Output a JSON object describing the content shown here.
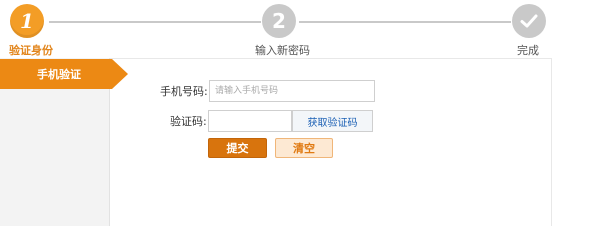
{
  "steps": [
    {
      "number": "1",
      "label": "验证身份",
      "state": "active"
    },
    {
      "number": "2",
      "label": "输入新密码",
      "state": "inactive"
    },
    {
      "number": "",
      "label": "完成",
      "state": "inactive",
      "icon": "check-icon"
    }
  ],
  "colors": {
    "accent": "#ec8914",
    "inactive": "#c9c9c9",
    "link": "#1a5fb4"
  },
  "sidebar": {
    "tab_label": "手机验证"
  },
  "form": {
    "phone_label": "手机号码:",
    "phone_placeholder": "请输入手机号码",
    "phone_value": "",
    "code_label": "验证码:",
    "code_value": "",
    "get_code_label": "获取验证码",
    "submit_label": "提交",
    "clear_label": "清空"
  }
}
